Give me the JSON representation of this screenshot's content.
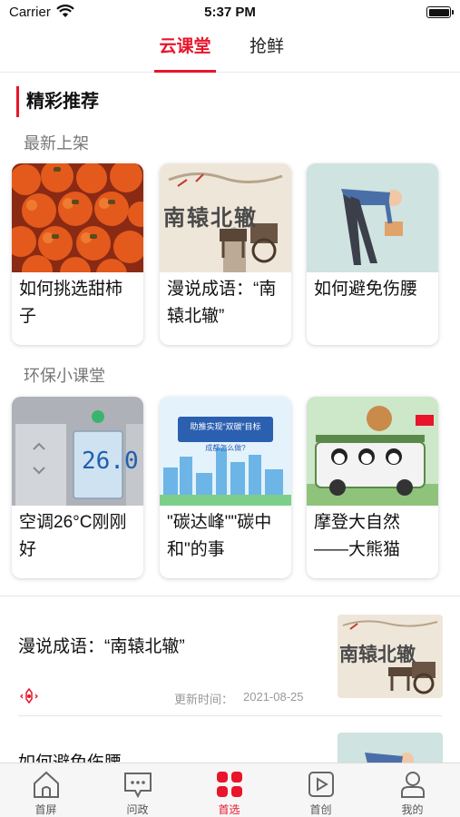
{
  "status_bar": {
    "carrier": "Carrier",
    "time": "5:37 PM"
  },
  "top_tabs": [
    {
      "label": "云课堂",
      "active": true
    },
    {
      "label": "抢鲜",
      "active": false
    }
  ],
  "section": {
    "title": "精彩推荐"
  },
  "groups": [
    {
      "title": "最新上架",
      "cards": [
        {
          "title": "如何挑选甜柿子",
          "thumb": "persimmons"
        },
        {
          "title": "漫说成语：“南辕北辙”",
          "thumb": "carriage-illustration",
          "thumb_text": "南辕北辙"
        },
        {
          "title": "如何避免伤腰",
          "thumb": "man-lifting-box"
        }
      ]
    },
    {
      "title": "环保小课堂",
      "cards": [
        {
          "title": "空调26°C刚刚好",
          "thumb": "ac-panel",
          "thumb_text": "26.0"
        },
        {
          "title": "\"碳达峰\"\"碳中和\"的事",
          "thumb": "city-skyline",
          "thumb_text": "助推实现“双碳”目标",
          "thumb_subtext": "成都怎么做?"
        },
        {
          "title": "摩登大自然——大熊猫",
          "thumb": "panda-bus"
        }
      ]
    }
  ],
  "list": [
    {
      "title": "漫说成语：“南辕北辙”",
      "updated_label": "更新时间：",
      "date": "2021-08-25",
      "thumb": "carriage-illustration",
      "thumb_text": "南辕北辙"
    },
    {
      "title": "如何避免伤腰",
      "thumb": "man-lifting-box"
    }
  ],
  "bottom_nav": [
    {
      "label": "首屏",
      "icon": "home-icon",
      "active": false
    },
    {
      "label": "问政",
      "icon": "chat-icon",
      "active": false
    },
    {
      "label": "首选",
      "icon": "grid-icon",
      "active": true
    },
    {
      "label": "首创",
      "icon": "video-icon",
      "active": false
    },
    {
      "label": "我的",
      "icon": "profile-icon",
      "active": false
    }
  ],
  "colors": {
    "accent": "#e8152b",
    "divider": "#e4e4e4",
    "nav_bg": "#f6f6f6"
  }
}
